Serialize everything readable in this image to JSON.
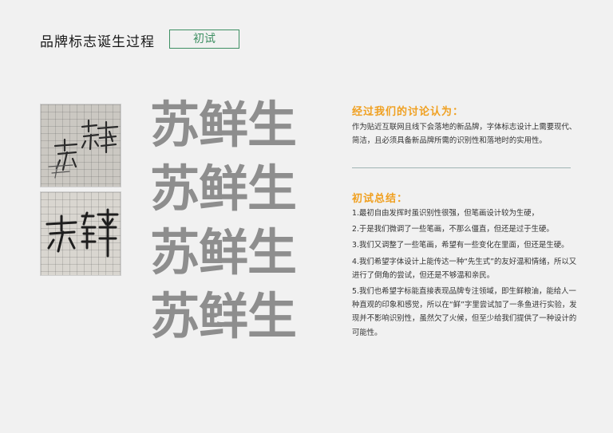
{
  "header": {
    "title": "品牌标志诞生过程",
    "badge": "初试"
  },
  "logo": {
    "text": "苏鲜生",
    "rows": [
      {
        "text": "苏鲜生"
      },
      {
        "text": "苏鲜生"
      },
      {
        "text": "苏鲜生"
      },
      {
        "text": "苏鲜生"
      }
    ],
    "color": "#8e8e8e"
  },
  "sketches": [
    {
      "description_text": "苏鲜"
    },
    {
      "description_text": "苏鲜"
    }
  ],
  "discussion": {
    "heading": "经过我们的讨论认为：",
    "body": "作为贴近互联网且线下会落地的新品牌，字体标志设计上需要现代、简洁，且必须具备新品牌所需的识别性和落地时的实用性。"
  },
  "summary": {
    "heading": "初试总结：",
    "items": [
      "1.最初自由发挥时虽识别性很强，但笔画设计较为生硬，",
      "2.于是我们微调了一些笔画，不那么僵直，但还是过于生硬。",
      "3.我们又调整了一些笔画，希望有一些变化在里面，但还是生硬。",
      "4.我们希望字体设计上能传达一种“先生式”的友好温和情绪，所以又进行了倒角的尝试，但还是不够温和亲民。",
      "5.我们也希望字标能直接表现品牌专注领域，即生鲜粮油，能给人一种直观的印象和感觉，所以在“鲜”字里尝试加了一条鱼进行实验，发现并不影响识别性，虽然欠了火候，但至少给我们提供了一种设计的可能性。"
    ]
  },
  "colors": {
    "accent_green": "#3e8f63",
    "heading_orange": "#f0a020",
    "background": "#f1f1f1"
  }
}
